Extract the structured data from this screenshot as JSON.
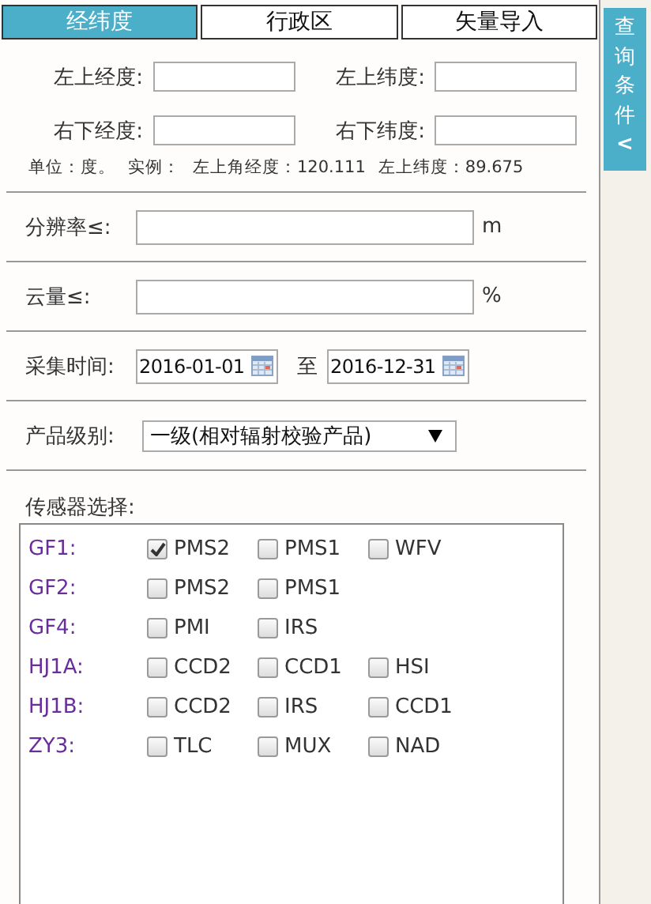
{
  "tabs": [
    {
      "label": "经纬度",
      "selected": true
    },
    {
      "label": "行政区",
      "selected": false
    },
    {
      "label": "矢量导入",
      "selected": false
    }
  ],
  "side_tab": {
    "label": "查询条件",
    "arrow": "<"
  },
  "coordinates": {
    "fields": [
      {
        "label": "左上经度:"
      },
      {
        "label": "左上纬度:"
      },
      {
        "label": "右下经度:"
      },
      {
        "label": "右下纬度:"
      }
    ],
    "note": [
      "单位：度。",
      "实例：",
      "左上角经度：120.111",
      "左上纬度：89.675"
    ]
  },
  "resolution": {
    "label": "分辨率≤:",
    "unit": "m"
  },
  "cloud": {
    "label": "云量≤:",
    "unit": "%"
  },
  "time": {
    "label": "采集时间:",
    "start": "2016-01-01",
    "separator": "至",
    "end": "2016-12-31"
  },
  "product": {
    "label": "产品级别:",
    "value": "一级(相对辐射校验产品)"
  },
  "sensors": {
    "label": "传感器选择:",
    "satellites": [
      {
        "name": "GF1:",
        "options": [
          {
            "label": "PMS2",
            "checked": true
          },
          {
            "label": "PMS1",
            "checked": false
          },
          {
            "label": "WFV",
            "checked": false
          }
        ]
      },
      {
        "name": "GF2:",
        "options": [
          {
            "label": "PMS2",
            "checked": false
          },
          {
            "label": "PMS1",
            "checked": false
          }
        ]
      },
      {
        "name": "GF4:",
        "options": [
          {
            "label": "PMI",
            "checked": false
          },
          {
            "label": "IRS",
            "checked": false
          }
        ]
      },
      {
        "name": "HJ1A:",
        "options": [
          {
            "label": "CCD2",
            "checked": false
          },
          {
            "label": "CCD1",
            "checked": false
          },
          {
            "label": "HSI",
            "checked": false
          }
        ]
      },
      {
        "name": "HJ1B:",
        "options": [
          {
            "label": "CCD2",
            "checked": false
          },
          {
            "label": "IRS",
            "checked": false
          },
          {
            "label": "CCD1",
            "checked": false
          }
        ]
      },
      {
        "name": "ZY3:",
        "options": [
          {
            "label": "TLC",
            "checked": false
          },
          {
            "label": "MUX",
            "checked": false
          },
          {
            "label": "NAD",
            "checked": false
          }
        ]
      }
    ]
  }
}
